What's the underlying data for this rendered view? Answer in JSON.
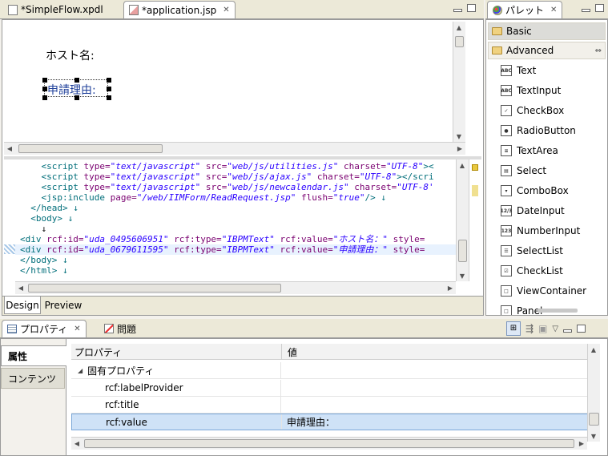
{
  "editor": {
    "tabs": [
      {
        "label": "*SimpleFlow.xpdl"
      },
      {
        "label": "*application.jsp"
      }
    ],
    "design": {
      "host_label": "ホスト名:",
      "request_label": "申請理由:"
    },
    "code_lines": [
      {
        "segs": [
          [
            "    ",
            ""
          ],
          [
            "<script ",
            "tag"
          ],
          [
            "type=",
            "attr"
          ],
          [
            "\"text/javascript\" ",
            "val"
          ],
          [
            "src=",
            "attr"
          ],
          [
            "\"web/js/utilities.js\" ",
            "val"
          ],
          [
            "charset=",
            "attr"
          ],
          [
            "\"UTF-8\"",
            "val"
          ],
          [
            "><",
            "tag"
          ]
        ]
      },
      {
        "segs": [
          [
            "    ",
            ""
          ],
          [
            "<script ",
            "tag"
          ],
          [
            "type=",
            "attr"
          ],
          [
            "\"text/javascript\" ",
            "val"
          ],
          [
            "src=",
            "attr"
          ],
          [
            "\"web/js/ajax.js\" ",
            "val"
          ],
          [
            "charset=",
            "attr"
          ],
          [
            "\"UTF-8\"",
            "val"
          ],
          [
            "></scri",
            "tag"
          ]
        ]
      },
      {
        "segs": [
          [
            "    ",
            ""
          ],
          [
            "<script ",
            "tag"
          ],
          [
            "type=",
            "attr"
          ],
          [
            "\"text/javascript\" ",
            "val"
          ],
          [
            "src=",
            "attr"
          ],
          [
            "\"web/js/newcalendar.js\" ",
            "val"
          ],
          [
            "charset=",
            "attr"
          ],
          [
            "\"UTF-8'",
            "val"
          ]
        ]
      },
      {
        "segs": [
          [
            "    ",
            ""
          ],
          [
            "<jsp:include ",
            "tag"
          ],
          [
            "page=",
            "attr"
          ],
          [
            "\"/web/IIMForm/ReadRequest.jsp\" ",
            "val"
          ],
          [
            "flush=",
            "attr"
          ],
          [
            "\"true\"",
            "val"
          ],
          [
            "/> ↓",
            "tag"
          ]
        ]
      },
      {
        "segs": [
          [
            "  ",
            ""
          ],
          [
            "</head> ↓",
            "tag"
          ]
        ]
      },
      {
        "segs": [
          [
            "  ",
            ""
          ],
          [
            "<body> ↓",
            "tag"
          ]
        ]
      },
      {
        "segs": [
          [
            "    ↓",
            ""
          ]
        ]
      },
      {
        "segs": [
          [
            "<div ",
            "tag"
          ],
          [
            "rcf:id=",
            "attr"
          ],
          [
            "\"uda_0495606951\" ",
            "val"
          ],
          [
            "rcf:type=",
            "attr"
          ],
          [
            "\"IBPMText\" ",
            "val"
          ],
          [
            "rcf:value=",
            "attr"
          ],
          [
            "\"ホスト名：\" ",
            "val"
          ],
          [
            "style=",
            "attr"
          ]
        ]
      },
      {
        "segs": [
          [
            "<div ",
            "tag"
          ],
          [
            "rcf:id=",
            "attr"
          ],
          [
            "\"uda_0679611595\" ",
            "val"
          ],
          [
            "rcf:type=",
            "attr"
          ],
          [
            "\"IBPMText\" ",
            "val"
          ],
          [
            "rcf:value=",
            "attr"
          ],
          [
            "\"申請理由：\" ",
            "val"
          ],
          [
            "style=",
            "attr"
          ]
        ]
      },
      {
        "segs": [
          [
            "</body> ↓",
            "tag"
          ]
        ]
      },
      {
        "segs": [
          [
            "</html> ↓",
            "tag"
          ]
        ]
      }
    ],
    "bottom_tabs": [
      {
        "label": "Design"
      },
      {
        "label": "Preview"
      }
    ]
  },
  "palette": {
    "title": "パレット",
    "drawers": [
      {
        "label": "Basic"
      },
      {
        "label": "Advanced"
      }
    ],
    "items": [
      {
        "label": "Text",
        "icon": "ABC"
      },
      {
        "label": "TextInput",
        "icon": "ABC"
      },
      {
        "label": "CheckBox",
        "icon": "✓"
      },
      {
        "label": "RadioButton",
        "icon": "●"
      },
      {
        "label": "TextArea",
        "icon": "≡"
      },
      {
        "label": "Select",
        "icon": "▤"
      },
      {
        "label": "ComboBox",
        "icon": "▾"
      },
      {
        "label": "DateInput",
        "icon": "12/3"
      },
      {
        "label": "NumberInput",
        "icon": "123"
      },
      {
        "label": "SelectList",
        "icon": "☰"
      },
      {
        "label": "CheckList",
        "icon": "☑"
      },
      {
        "label": "ViewContainer",
        "icon": "□"
      },
      {
        "label": "Panel",
        "icon": "□"
      }
    ]
  },
  "properties": {
    "tabs": [
      {
        "label": "プロパティ"
      },
      {
        "label": "問題"
      }
    ],
    "side_tabs": [
      {
        "label": "属性"
      },
      {
        "label": "コンテンツ"
      }
    ],
    "col_property": "プロパティ",
    "col_value": "値",
    "group": "固有プロパティ",
    "rows": [
      {
        "name": "rcf:labelProvider",
        "value": ""
      },
      {
        "name": "rcf:title",
        "value": ""
      },
      {
        "name": "rcf:value",
        "value": "申請理由："
      }
    ]
  }
}
